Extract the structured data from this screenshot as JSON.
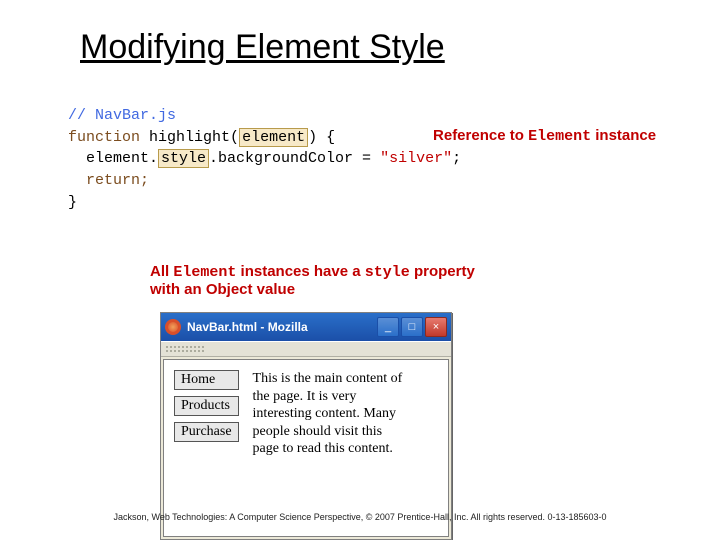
{
  "title": "Modifying Element Style",
  "code": {
    "comment": "// NavBar.js",
    "func_kw": "function",
    "func_name": "highlight",
    "param": "element",
    "open": ") {",
    "line2_pre": "  element.",
    "line2_hi": "style",
    "line2_post": ".backgroundColor = ",
    "line2_str": "\"silver\"",
    "line2_end": ";",
    "return": "  return;",
    "close": "}"
  },
  "annot1_pre": "Reference to ",
  "annot1_code": "Element",
  "annot1_post": " instance",
  "annot2_pre": "All ",
  "annot2_code1": "Element",
  "annot2_mid": " instances have a ",
  "annot2_code2": "style",
  "annot2_post": " property",
  "annot2_line2": "with an Object value",
  "browser": {
    "title": "NavBar.html - Mozilla",
    "min": "_",
    "max": "□",
    "close": "×",
    "nav": [
      "Home",
      "Products",
      "Purchase"
    ],
    "maintext": "This is the main content of the page. It is very interesting content. Many people should visit this page to read this content."
  },
  "footer": "Jackson, Web Technologies: A Computer Science Perspective, © 2007 Prentice-Hall, Inc. All rights reserved. 0-13-185603-0"
}
